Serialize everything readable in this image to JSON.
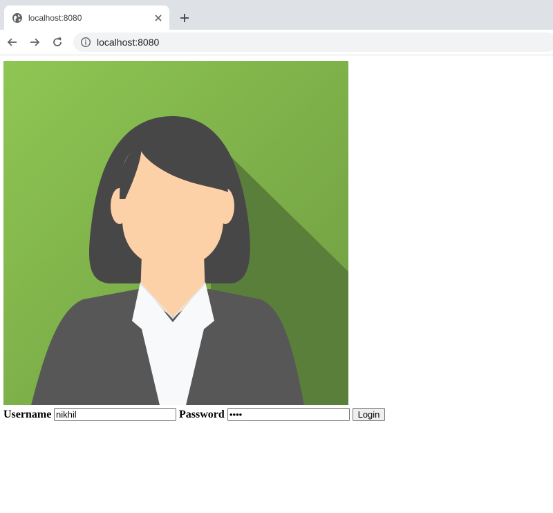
{
  "browser": {
    "tab_title": "localhost:8080",
    "url": "localhost:8080",
    "icons": {
      "favicon": "globe-icon",
      "tab_close": "close-icon",
      "new_tab": "plus-icon",
      "back": "arrow-left-icon",
      "forward": "arrow-right-icon",
      "reload": "reload-icon",
      "site_info": "info-icon"
    }
  },
  "avatar": {
    "description_icon": "woman-avatar-icon",
    "colors": {
      "background": "#8bc34a",
      "shadow": "#5a7f3a",
      "hair": "#474747",
      "skin": "#fcd1a8",
      "jacket": "#575757",
      "shirt": "#f7f9fb"
    }
  },
  "login": {
    "username_label": "Username",
    "username_value": "nikhil",
    "password_label": "Password",
    "password_value": "••••",
    "submit_label": "Login"
  }
}
